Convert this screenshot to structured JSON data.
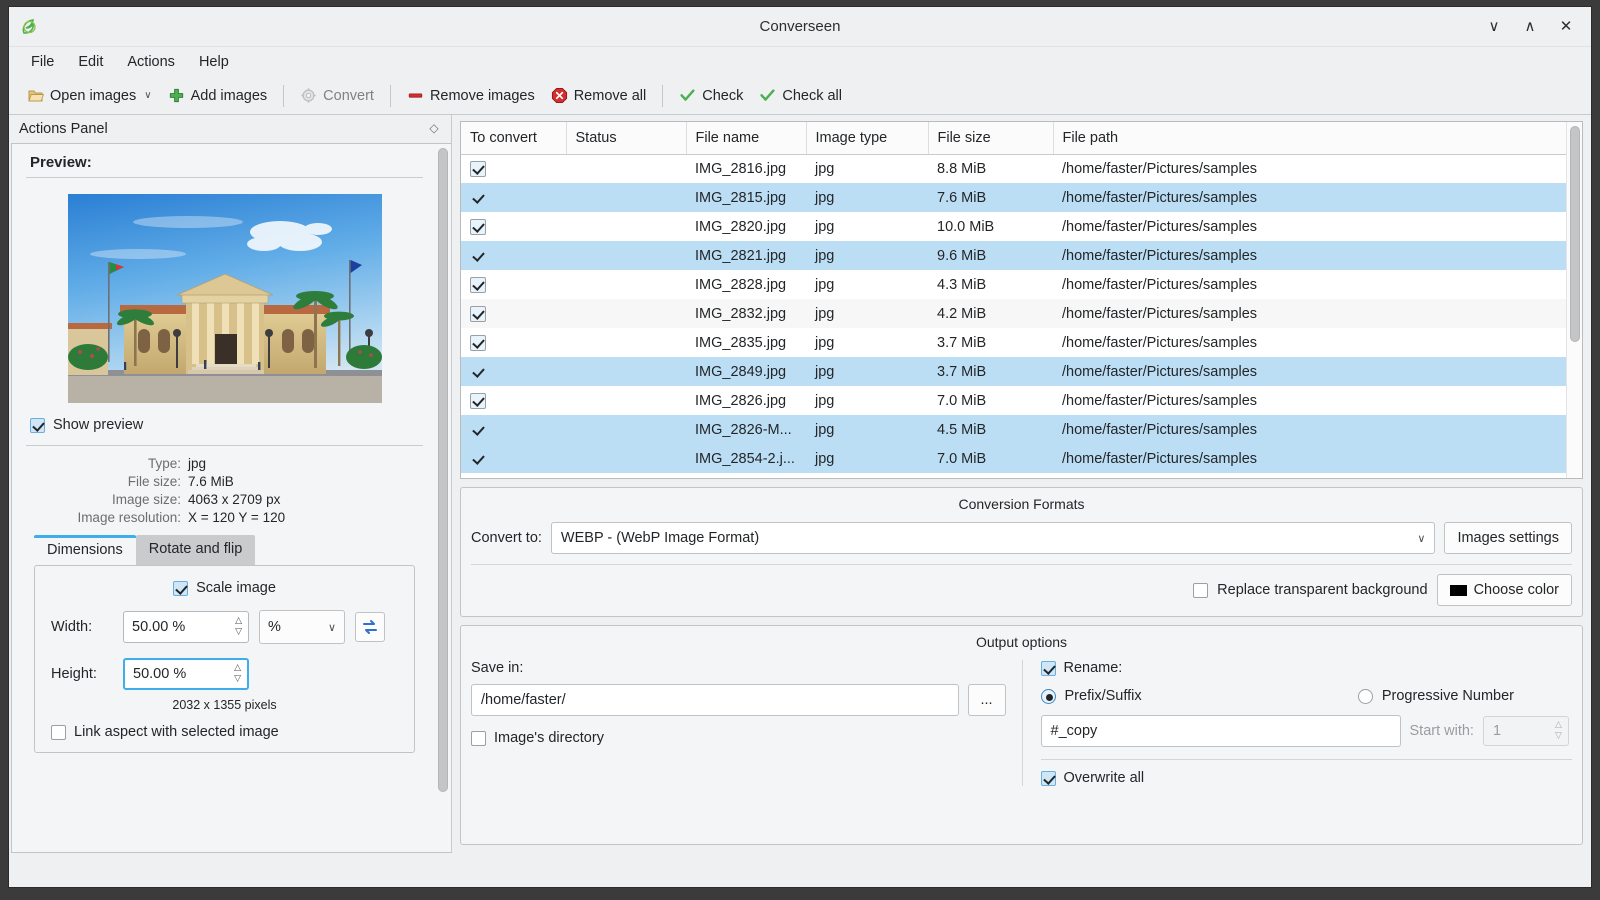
{
  "window": {
    "title": "Converseen",
    "logo_icon": "converseen-leaf-icon",
    "controls": [
      {
        "name": "minimize-button",
        "glyph": "∨"
      },
      {
        "name": "maximize-button",
        "glyph": "∧"
      },
      {
        "name": "close-button",
        "glyph": "✕"
      }
    ]
  },
  "menubar": {
    "items": [
      {
        "label": "File"
      },
      {
        "label": "Edit"
      },
      {
        "label": "Actions"
      },
      {
        "label": "Help"
      }
    ]
  },
  "toolbar": {
    "open_images": "Open images",
    "open_images_caret": "∨",
    "add_images": "Add images",
    "convert": "Convert",
    "remove_images": "Remove images",
    "remove_all": "Remove all",
    "check": "Check",
    "check_all": "Check all"
  },
  "actions_panel": {
    "title": "Actions Panel",
    "preview_label": "Preview:",
    "show_preview_label": "Show preview",
    "show_preview_checked": true,
    "info": [
      {
        "label": "Type:",
        "value": "jpg"
      },
      {
        "label": "File size:",
        "value": "7.6 MiB"
      },
      {
        "label": "Image size:",
        "value": "4063 x 2709 px"
      },
      {
        "label": "Image resolution:",
        "value": "X = 120 Y = 120"
      }
    ],
    "tabs": [
      {
        "label": "Dimensions",
        "active": true
      },
      {
        "label": "Rotate and flip",
        "active": false
      }
    ],
    "dimensions": {
      "scale_image_label": "Scale image",
      "scale_image_checked": true,
      "width_label": "Width:",
      "width_value": "50.00 %",
      "height_label": "Height:",
      "height_value": "50.00 %",
      "unit_value": "%",
      "unit_caret": "∨",
      "swap_icon": "swap-arrows-icon",
      "pixels_note": "2032 x 1355 pixels",
      "link_aspect_label": "Link aspect with selected image",
      "link_aspect_checked": false
    }
  },
  "file_table": {
    "columns": [
      "To convert",
      "Status",
      "File name",
      "Image type",
      "File size",
      "File path"
    ],
    "rows": [
      {
        "checked": true,
        "status": "",
        "file_name": "IMG_2816.jpg",
        "image_type": "jpg",
        "file_size": "8.8 MiB",
        "file_path": "/home/faster/Pictures/samples",
        "selected": false,
        "alt": false
      },
      {
        "checked": true,
        "status": "",
        "file_name": "IMG_2815.jpg",
        "image_type": "jpg",
        "file_size": "7.6 MiB",
        "file_path": "/home/faster/Pictures/samples",
        "selected": true,
        "alt": false
      },
      {
        "checked": true,
        "status": "",
        "file_name": "IMG_2820.jpg",
        "image_type": "jpg",
        "file_size": "10.0 MiB",
        "file_path": "/home/faster/Pictures/samples",
        "selected": false,
        "alt": false
      },
      {
        "checked": true,
        "status": "",
        "file_name": "IMG_2821.jpg",
        "image_type": "jpg",
        "file_size": "9.6 MiB",
        "file_path": "/home/faster/Pictures/samples",
        "selected": true,
        "alt": false
      },
      {
        "checked": true,
        "status": "",
        "file_name": "IMG_2828.jpg",
        "image_type": "jpg",
        "file_size": "4.3 MiB",
        "file_path": "/home/faster/Pictures/samples",
        "selected": false,
        "alt": false
      },
      {
        "checked": true,
        "status": "",
        "file_name": "IMG_2832.jpg",
        "image_type": "jpg",
        "file_size": "4.2 MiB",
        "file_path": "/home/faster/Pictures/samples",
        "selected": false,
        "alt": true
      },
      {
        "checked": true,
        "status": "",
        "file_name": "IMG_2835.jpg",
        "image_type": "jpg",
        "file_size": "3.7 MiB",
        "file_path": "/home/faster/Pictures/samples",
        "selected": false,
        "alt": false
      },
      {
        "checked": true,
        "status": "",
        "file_name": "IMG_2849.jpg",
        "image_type": "jpg",
        "file_size": "3.7 MiB",
        "file_path": "/home/faster/Pictures/samples",
        "selected": true,
        "alt": false
      },
      {
        "checked": true,
        "status": "",
        "file_name": "IMG_2826.jpg",
        "image_type": "jpg",
        "file_size": "7.0 MiB",
        "file_path": "/home/faster/Pictures/samples",
        "selected": false,
        "alt": false
      },
      {
        "checked": true,
        "status": "",
        "file_name": "IMG_2826-M...",
        "image_type": "jpg",
        "file_size": "4.5 MiB",
        "file_path": "/home/faster/Pictures/samples",
        "selected": true,
        "alt": false
      },
      {
        "checked": true,
        "status": "",
        "file_name": "IMG_2854-2.j...",
        "image_type": "jpg",
        "file_size": "7.0 MiB",
        "file_path": "/home/faster/Pictures/samples",
        "selected": true,
        "alt": false
      }
    ]
  },
  "conversion_formats": {
    "title": "Conversion Formats",
    "convert_to_label": "Convert to:",
    "convert_to_value": "WEBP - (WebP Image Format)",
    "caret": "∨",
    "images_settings_label": "Images settings",
    "replace_transparent_label": "Replace transparent background",
    "replace_transparent_checked": false,
    "choose_color_label": "Choose color",
    "choose_color_value": "#000000"
  },
  "output_options": {
    "title": "Output options",
    "save_in_label": "Save in:",
    "save_in_value": "/home/faster/",
    "browse_label": "...",
    "image_directory_label": "Image's directory",
    "image_directory_checked": false,
    "rename_label": "Rename:",
    "rename_checked": true,
    "prefix_suffix_label": "Prefix/Suffix",
    "prefix_suffix_selected": true,
    "progressive_number_label": "Progressive Number",
    "progressive_number_selected": false,
    "prefix_value": "#_copy",
    "start_with_label": "Start with:",
    "start_with_value": "1",
    "overwrite_all_label": "Overwrite all",
    "overwrite_all_checked": true
  }
}
